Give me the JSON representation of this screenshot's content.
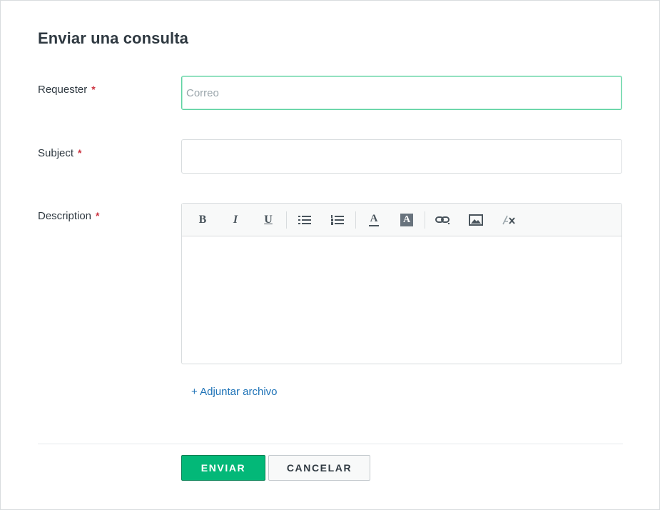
{
  "form": {
    "title": "Enviar una consulta",
    "required_marker": "*",
    "requester": {
      "label": "Requester",
      "placeholder": "Correo",
      "value": ""
    },
    "subject": {
      "label": "Subject",
      "value": ""
    },
    "description": {
      "label": "Description",
      "value": ""
    },
    "toolbar": {
      "bold": "B",
      "italic": "I",
      "underline": "U",
      "text_color": "A",
      "background_color": "A"
    },
    "attach_label": "+ Adjuntar archivo",
    "submit_label": "ENVIAR",
    "cancel_label": "CANCELAR"
  },
  "icons": [
    "bold-icon",
    "italic-icon",
    "underline-icon",
    "bulleted-list-icon",
    "numbered-list-icon",
    "text-color-icon",
    "background-color-icon",
    "link-icon",
    "image-icon",
    "clear-formatting-icon"
  ],
  "colors": {
    "primary": "#03b878",
    "link": "#1f73b7",
    "required": "#cc3340",
    "focus_border": "#5ad1a0"
  }
}
